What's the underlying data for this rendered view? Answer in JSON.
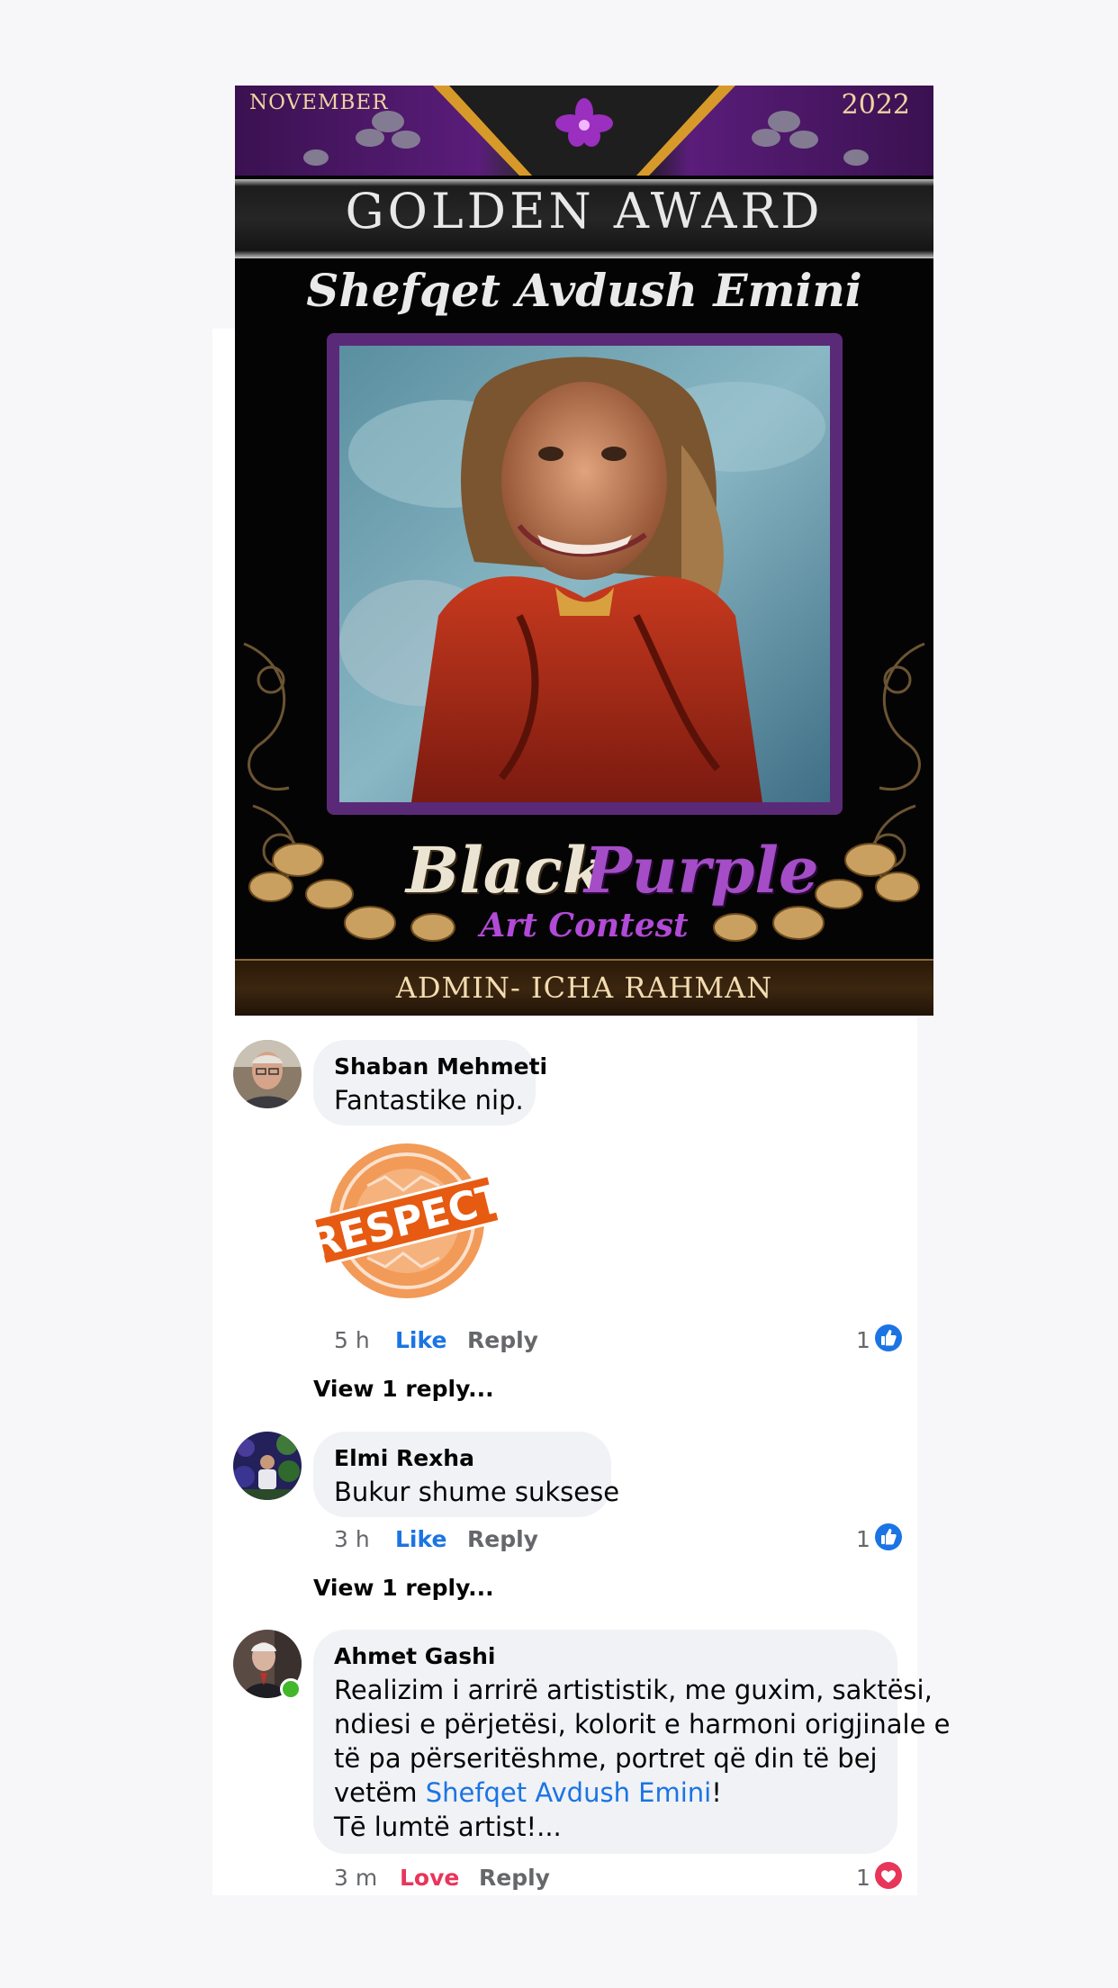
{
  "poster": {
    "month": "NOVEMBER",
    "year": "2022",
    "title": "GOLDEN  AWARD",
    "artist": "Shefqet Avdush Emini",
    "brand_black": "Black",
    "brand_purple": "Purple",
    "brand_sub": "Art Contest",
    "admin": "ADMIN- ICHA RAHMAN"
  },
  "comments": [
    {
      "name": "Shaban Mehmeti",
      "text": "Fantastike nip.",
      "sticker": "RESPECT",
      "time": "5 h",
      "reaction_label": "Like",
      "reply_label": "Reply",
      "reaction_count": "1",
      "reaction_icon": "like-icon",
      "view_replies": "View 1 reply..."
    },
    {
      "name": "Elmi Rexha",
      "text": "Bukur shume suksese",
      "time": "3 h",
      "reaction_label": "Like",
      "reply_label": "Reply",
      "reaction_count": "1",
      "reaction_icon": "like-icon",
      "view_replies": "View 1 reply..."
    },
    {
      "name": "Ahmet Gashi",
      "lines": [
        "Realizim i arrirë artististik, me guxim, saktësi,",
        "ndiesi e përjetësi, kolorit e harmoni origjinale e",
        "të pa përseritëshme, portret që din të bej"
      ],
      "line4_before": "vetëm ",
      "mention": "Shefqet Avdush Emini",
      "line4_after": "!",
      "line5": "Tē lumtë artist!...",
      "time": "3 m",
      "reaction_label": "Love",
      "reply_label": "Reply",
      "reaction_count": "1",
      "reaction_icon": "love-icon",
      "online": true
    }
  ],
  "colors": {
    "like_blue": "#1b74e4",
    "love_red": "#e8355a",
    "bubble": "#f0f2f5",
    "meta_gray": "#65676b",
    "online_green": "#42b72a"
  }
}
